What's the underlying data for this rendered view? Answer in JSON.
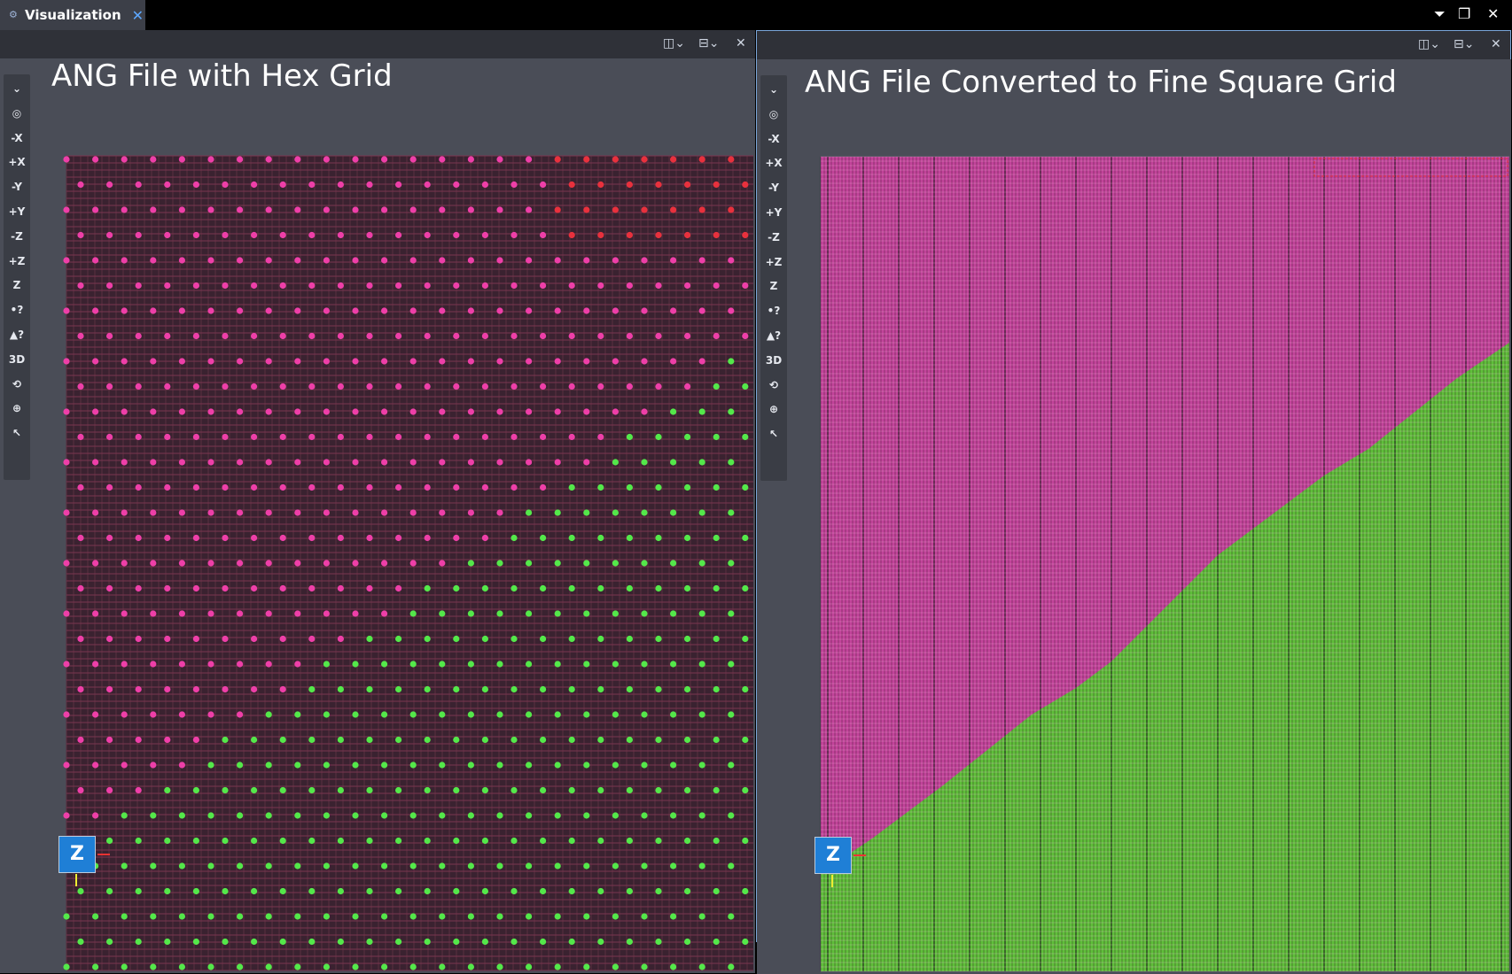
{
  "tab": {
    "icon": "visualization-icon",
    "label": "Visualization",
    "close": "✕"
  },
  "window_controls": [
    {
      "name": "view-menu",
      "glyph": "⏷"
    },
    {
      "name": "restore",
      "glyph": "❐"
    },
    {
      "name": "close",
      "glyph": "✕"
    }
  ],
  "view_toolbar": [
    {
      "name": "orient-menu",
      "label": "⌄",
      "icon": "chevron-down-icon"
    },
    {
      "name": "camera",
      "label": "◎",
      "icon": "camera-icon"
    },
    {
      "name": "view-minus-x",
      "label": "-X"
    },
    {
      "name": "view-plus-x",
      "label": "+X"
    },
    {
      "name": "view-minus-y",
      "label": "-Y"
    },
    {
      "name": "view-plus-y",
      "label": "+Y"
    },
    {
      "name": "view-minus-z",
      "label": "-Z"
    },
    {
      "name": "view-plus-z",
      "label": "+Z"
    },
    {
      "name": "z-axis-tool",
      "label": "Z",
      "icon": "z-axis-icon"
    },
    {
      "name": "point-query",
      "label": "•?",
      "icon": "point-query-icon"
    },
    {
      "name": "cell-query",
      "label": "▲?",
      "icon": "cell-query-icon"
    },
    {
      "name": "toggle-3d-2d",
      "label": "3D",
      "icon": "3d-2d-icon"
    },
    {
      "name": "reset-rotation",
      "label": "⟲",
      "icon": "rotate-icon"
    },
    {
      "name": "zoom",
      "label": "⊕",
      "icon": "zoom-icon"
    },
    {
      "name": "pick",
      "label": "↖",
      "icon": "pick-icon"
    }
  ],
  "views": {
    "left": {
      "title": "ANG File with Hex Grid"
    },
    "right": {
      "title": "ANG File Converted to Fine Square Grid"
    }
  },
  "axis_widget": {
    "label": "Z"
  },
  "colors": {
    "pink": "#ee3fa8",
    "green": "#54e84a",
    "red": "#e8313d",
    "background": "#4a4d57",
    "highlight": "#7aa6d9"
  }
}
